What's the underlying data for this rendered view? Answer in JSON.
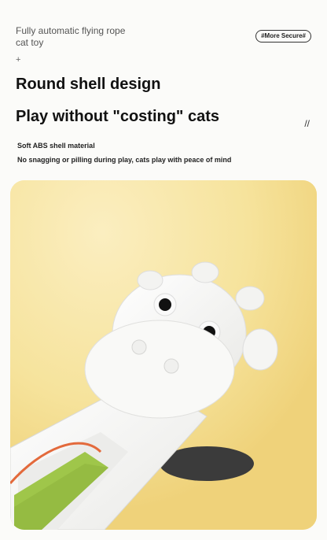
{
  "header": {
    "product_label": "Fully automatic flying rope cat toy",
    "badge": "#More Secure#",
    "plus": "+",
    "title": "Round shell design",
    "subtitle": "Play without \"costing\" cats",
    "slash": "//"
  },
  "features": {
    "material": "Soft ABS shell material",
    "benefit": "No snagging or pilling during play, cats play with peace of mind"
  },
  "colors": {
    "background": "#fbfbf9",
    "photo_bg": "#f5e39f",
    "shell": "#f7f7f5",
    "carpet": "#9fc64a",
    "rope": "#e36a3c"
  }
}
